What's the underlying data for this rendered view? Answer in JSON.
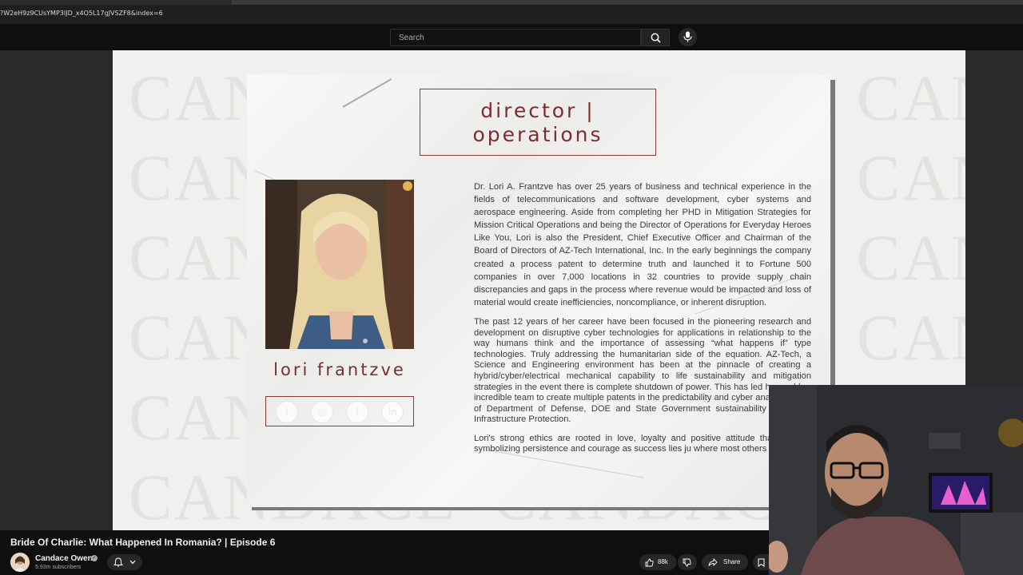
{
  "browser": {
    "url": "?W2eH9z9CUsYMP3IJD_x4O5L17gJVSZF8&index=6"
  },
  "search": {
    "placeholder": "Search"
  },
  "slide": {
    "watermark_word": "CANDACE",
    "title_line1": "director |",
    "title_line2": "operations",
    "name": "lori frantzve",
    "social_icons": [
      "twitter-icon",
      "instagram-icon",
      "facebook-icon",
      "linkedin-icon"
    ],
    "bio_p1": "Dr. Lori A. Frantzve has over 25 years of business and technical experience in the fields of telecommunications and software development, cyber systems and aerospace engineering. Aside from completing her PHD in Mitigation Strategies for Mission Critical Operations and being the Director of Operations for Everyday Heroes Like You, Lori is also the President, Chief Executive Officer and Chairman of the Board of Directors of AZ-Tech International, Inc. In the early beginnings the company created a process patent to determine truth and launched it to Fortune 500 companies in over 7,000 locations in 32 countries to provide supply chain discrepancies and gaps in the process where revenue would be impacted and loss of material would create inefficiencies, noncompliance, or inherent disruption.",
    "bio_p2": "The past 12 years of her career have been focused in the pioneering research and development on disruptive cyber technologies for applications in relationship to the way humans think and the importance of assessing “what happens if” type technologies. Truly addressing the humanitarian side of the equation. AZ-Tech, a Science and Engineering environment has been at the pinnacle of creating a hybrid/cyber/electrical mechanical capability to life sustainability and mitigation strategies in the event there is complete shutdown of power. This has led her and her incredible team to create multiple patents in the predictability and cyber analyt support of Department of Defense, DOE and State Government sustainability of Critical Infrastructure Protection.",
    "bio_p3": "Lori's strong ethics are rooted in love, loyalty and positive attitude tha give up” symbolizing persistence and courage as success lies ju where most others quit."
  },
  "video": {
    "title": "Bride Of Charlie: What Happened In Romania? | Episode 6",
    "channel": "Candace Owens",
    "subscribers": "5.93m subscribers",
    "likes": "88k",
    "share_label": "Share"
  },
  "colors": {
    "accent": "#8c3a3a",
    "bg": "#0f0f0f"
  }
}
